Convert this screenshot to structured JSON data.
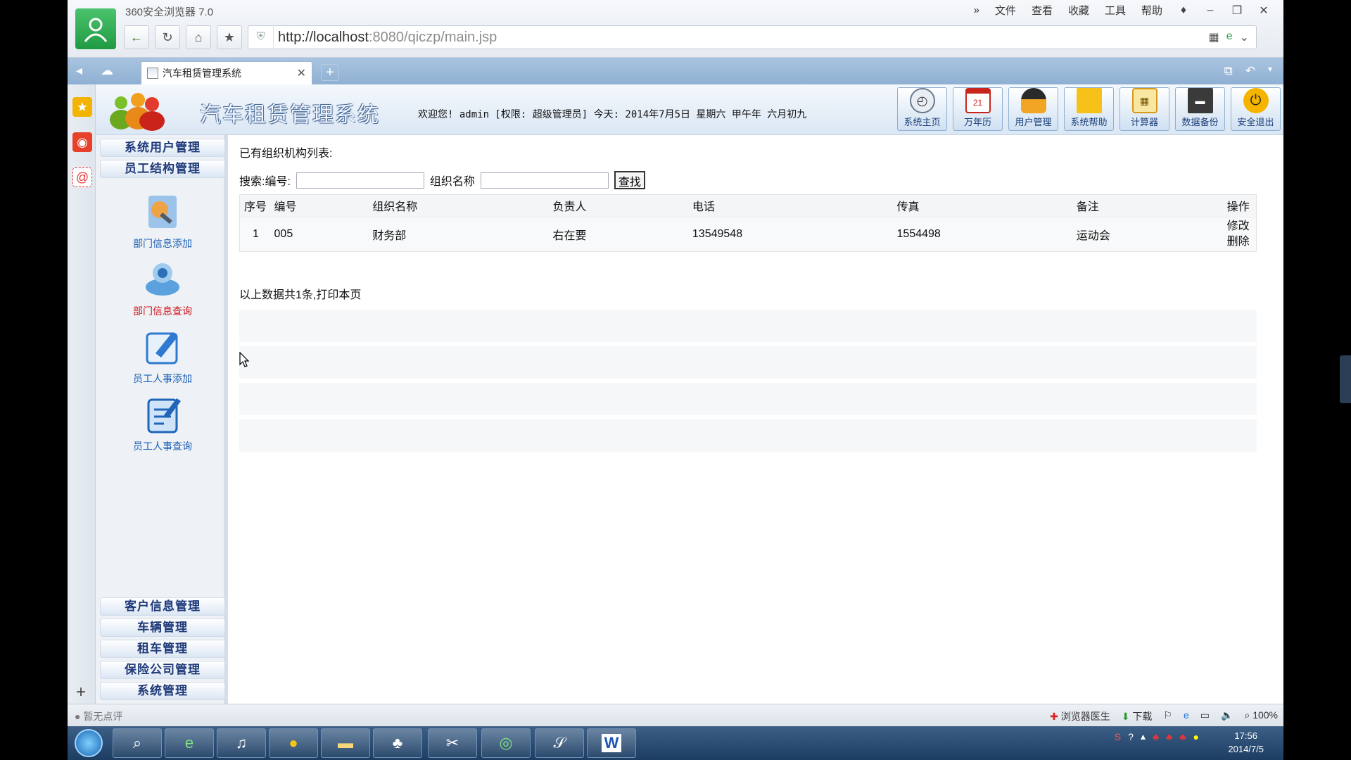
{
  "browser": {
    "name": "360安全浏览器 7.0",
    "menu": [
      "文件",
      "查看",
      "收藏",
      "工具",
      "帮助"
    ],
    "url_host": "http://localhost",
    "url_rest": ":8080/qiczp/main.jsp",
    "tab_title": "汽车租赁管理系统",
    "status_left": "暂无点评",
    "status_right": [
      "浏览器医生",
      "下载",
      "100%"
    ]
  },
  "header": {
    "app_title": "汽车租赁管理系统",
    "welcome": "欢迎您! admin [权限: 超级管理员] 今天: 2014年7月5日 星期六 甲午年 六月初九",
    "tools": [
      {
        "label": "系统主页",
        "icon": "clock-icon"
      },
      {
        "label": "万年历",
        "icon": "calendar-icon"
      },
      {
        "label": "用户管理",
        "icon": "user-icon"
      },
      {
        "label": "系统帮助",
        "icon": "help-icon"
      },
      {
        "label": "计算器",
        "icon": "calculator-icon"
      },
      {
        "label": "数据备份",
        "icon": "floppy-disk-icon"
      },
      {
        "label": "安全退出",
        "icon": "power-icon"
      }
    ]
  },
  "left_menu": {
    "top_groups": [
      "系统用户管理",
      "员工结构管理"
    ],
    "sub_items": [
      {
        "label": "部门信息添加",
        "color": "#1a5fb4",
        "icon": "department-add-icon"
      },
      {
        "label": "部门信息查询",
        "color": "#d0131a",
        "icon": "department-search-icon"
      },
      {
        "label": "员工人事添加",
        "color": "#1a5fb4",
        "icon": "employee-add-icon"
      },
      {
        "label": "员工人事查询",
        "color": "#1a5fb4",
        "icon": "employee-search-icon"
      }
    ],
    "bottom_groups": [
      "客户信息管理",
      "车辆管理",
      "租车管理",
      "保险公司管理",
      "系统管理"
    ]
  },
  "main": {
    "list_title": "已有组织机构列表:",
    "search_label_id": "搜索:编号:",
    "search_label_name": "组织名称",
    "search_button": "查找",
    "columns": [
      "序号",
      "编号",
      "组织名称",
      "负责人",
      "电话",
      "传真",
      "备注",
      "操作"
    ],
    "rows": [
      {
        "seq": "1",
        "id": "005",
        "name": "财务部",
        "leader": "右在要",
        "phone": "13549548",
        "fax": "1554498",
        "remark": "运动会",
        "edit": "修改",
        "delete": "删除"
      }
    ],
    "summary": "以上数据共1条,打印本页"
  },
  "taskbar": {
    "time": "17:56",
    "date": "2014/7/5"
  }
}
